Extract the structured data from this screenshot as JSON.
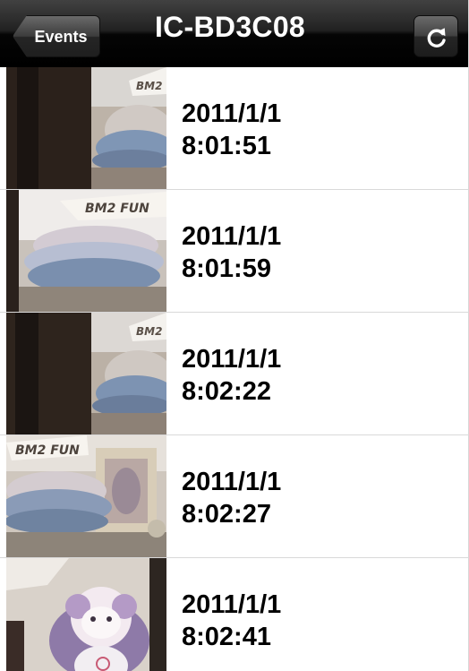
{
  "navbar": {
    "back_label": "Events",
    "title": "IC-BD3C08",
    "refresh_icon": "refresh-icon"
  },
  "events": [
    {
      "date": "2011/1/1",
      "time": "8:01:51",
      "thumb_variant": "plant-bowl",
      "sign_text": "BM2"
    },
    {
      "date": "2011/1/1",
      "time": "8:01:59",
      "thumb_variant": "bowl-sign",
      "sign_text": "BM2 FUN"
    },
    {
      "date": "2011/1/1",
      "time": "8:02:22",
      "thumb_variant": "plant-bowl",
      "sign_text": "BM2"
    },
    {
      "date": "2011/1/1",
      "time": "8:02:27",
      "thumb_variant": "bowl-frame",
      "sign_text": "BM2 FUN"
    },
    {
      "date": "2011/1/1",
      "time": "8:02:41",
      "thumb_variant": "doll",
      "sign_text": ""
    }
  ],
  "colors": {
    "navbar_top": "#414141",
    "navbar_bottom": "#000000",
    "separator": "#d9d9d9",
    "text": "#000000"
  }
}
